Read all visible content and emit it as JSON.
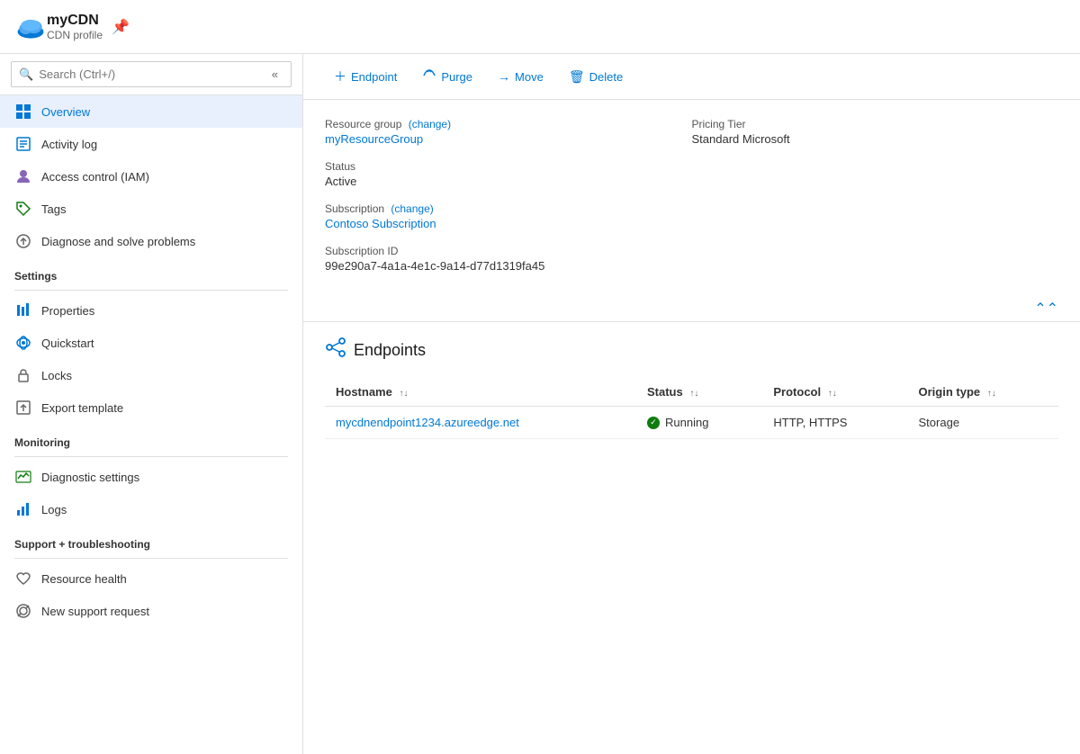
{
  "header": {
    "title": "myCDN",
    "subtitle": "CDN profile",
    "pin_icon": "📌"
  },
  "search": {
    "placeholder": "Search (Ctrl+/)"
  },
  "sidebar": {
    "nav_items": [
      {
        "id": "overview",
        "label": "Overview",
        "icon": "overview",
        "active": true
      },
      {
        "id": "activity-log",
        "label": "Activity log",
        "icon": "activity"
      },
      {
        "id": "access-control",
        "label": "Access control (IAM)",
        "icon": "iam"
      },
      {
        "id": "tags",
        "label": "Tags",
        "icon": "tags"
      },
      {
        "id": "diagnose",
        "label": "Diagnose and solve problems",
        "icon": "diagnose"
      }
    ],
    "sections": [
      {
        "label": "Settings",
        "items": [
          {
            "id": "properties",
            "label": "Properties",
            "icon": "properties"
          },
          {
            "id": "quickstart",
            "label": "Quickstart",
            "icon": "quickstart"
          },
          {
            "id": "locks",
            "label": "Locks",
            "icon": "locks"
          },
          {
            "id": "export-template",
            "label": "Export template",
            "icon": "export"
          }
        ]
      },
      {
        "label": "Monitoring",
        "items": [
          {
            "id": "diagnostic-settings",
            "label": "Diagnostic settings",
            "icon": "diagnostic"
          },
          {
            "id": "logs",
            "label": "Logs",
            "icon": "logs"
          }
        ]
      },
      {
        "label": "Support + troubleshooting",
        "items": [
          {
            "id": "resource-health",
            "label": "Resource health",
            "icon": "health"
          },
          {
            "id": "new-support-request",
            "label": "New support request",
            "icon": "support"
          }
        ]
      }
    ]
  },
  "toolbar": {
    "buttons": [
      {
        "id": "endpoint",
        "label": "Endpoint",
        "icon": "+"
      },
      {
        "id": "purge",
        "label": "Purge",
        "icon": "↻"
      },
      {
        "id": "move",
        "label": "Move",
        "icon": "→"
      },
      {
        "id": "delete",
        "label": "Delete",
        "icon": "🗑"
      }
    ]
  },
  "info": {
    "resource_group_label": "Resource group",
    "resource_group_change": "(change)",
    "resource_group_value": "myResourceGroup",
    "pricing_tier_label": "Pricing Tier",
    "pricing_tier_value": "Standard Microsoft",
    "status_label": "Status",
    "status_value": "Active",
    "subscription_label": "Subscription",
    "subscription_change": "(change)",
    "subscription_value": "Contoso Subscription",
    "subscription_id_label": "Subscription ID",
    "subscription_id_value": "99e290a7-4a1a-4e1c-9a14-d77d1319fa45"
  },
  "endpoints": {
    "section_title": "Endpoints",
    "columns": [
      {
        "id": "hostname",
        "label": "Hostname"
      },
      {
        "id": "status",
        "label": "Status"
      },
      {
        "id": "protocol",
        "label": "Protocol"
      },
      {
        "id": "origin_type",
        "label": "Origin type"
      }
    ],
    "rows": [
      {
        "hostname": "mycdnendpoint1234.azureedge.net",
        "status": "Running",
        "protocol": "HTTP, HTTPS",
        "origin_type": "Storage"
      }
    ]
  }
}
